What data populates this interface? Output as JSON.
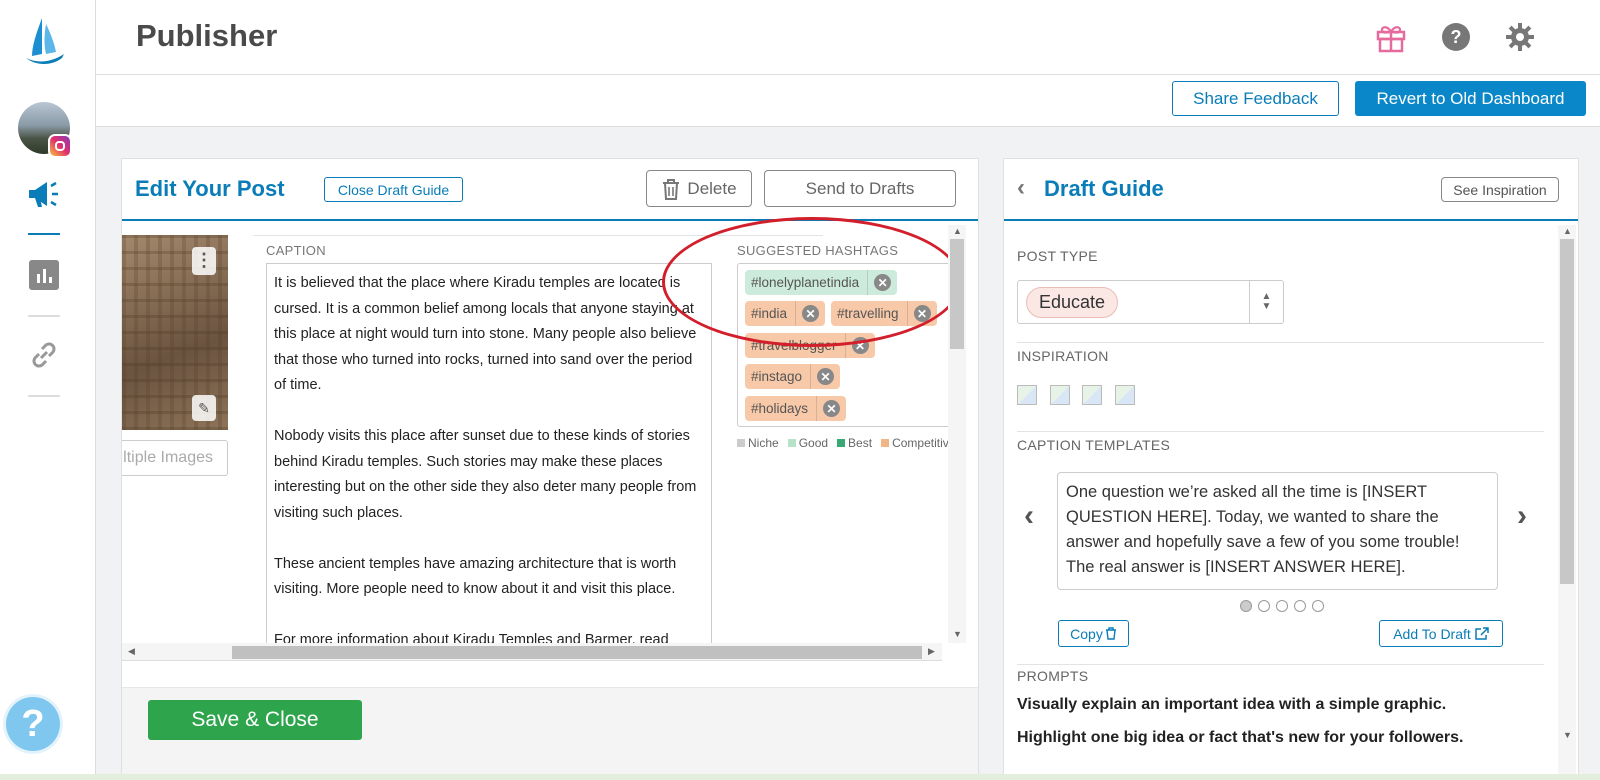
{
  "app": {
    "title": "Publisher"
  },
  "subbar": {
    "share_feedback": "Share Feedback",
    "revert": "Revert to Old Dashboard"
  },
  "edit_post": {
    "title": "Edit Your Post",
    "close_guide": "Close Draft Guide",
    "delete": "Delete",
    "send_to_drafts": "Send to Drafts",
    "multiple_images": "Multiple Images",
    "caption_label": "CAPTION",
    "caption_paragraphs": [
      "It is believed that the place where Kiradu temples are located is cursed. It is a common belief among locals that anyone staying at this place at night would turn into stone. Many people also believe that those who turned into rocks, turned into sand over the period of time.",
      "Nobody visits this place after sunset due to these kinds of stories behind Kiradu temples. Such stories may make these places interesting but on the other side they also deter many people from visiting such places.",
      "These ancient temples have amazing architecture that is worth visiting. More people need to know about it and visit this place.",
      "For more information about Kiradu Temples and Barmer, read"
    ],
    "hashtags_label": "SUGGESTED HASHTAGS",
    "hashtags": [
      {
        "text": "#lonelyplanetindia",
        "kind": "best"
      },
      {
        "text": "#india",
        "kind": "competitive"
      },
      {
        "text": "#travelling",
        "kind": "competitive"
      },
      {
        "text": "#travelblogger",
        "kind": "competitive"
      },
      {
        "text": "#instago",
        "kind": "competitive"
      },
      {
        "text": "#holidays",
        "kind": "competitive"
      }
    ],
    "legend": [
      {
        "label": "Niche",
        "color": "#cccccc"
      },
      {
        "label": "Good",
        "color": "#b7e1c9"
      },
      {
        "label": "Best",
        "color": "#3aa874"
      },
      {
        "label": "Competitive",
        "color": "#f3b487"
      }
    ],
    "save_close": "Save & Close"
  },
  "draft_guide": {
    "title": "Draft Guide",
    "see_inspiration": "See Inspiration",
    "post_type_label": "POST TYPE",
    "post_type_value": "Educate",
    "inspiration_label": "INSPIRATION",
    "caption_templates_label": "CAPTION TEMPLATES",
    "template_text": "One question we’re asked all the time is [INSERT QUESTION HERE]. Today, we wanted to share the answer and hopefully save a few of you some trouble! The real answer is [INSERT ANSWER HERE].",
    "copy": "Copy",
    "add_to_draft": "Add To Draft",
    "prompts_label": "PROMPTS",
    "prompts": [
      "Visually explain an important idea with a simple graphic.",
      "Highlight one big idea or fact that's new for your followers."
    ]
  },
  "colors": {
    "accent": "#0a7db8",
    "save": "#2ea54d",
    "annotation": "#d21f2b"
  },
  "icons": [
    "logo-sail-icon",
    "megaphone-icon",
    "analytics-icon",
    "link-icon",
    "gift-icon",
    "help-icon",
    "gear-icon",
    "trash-icon",
    "question-fab-icon"
  ]
}
